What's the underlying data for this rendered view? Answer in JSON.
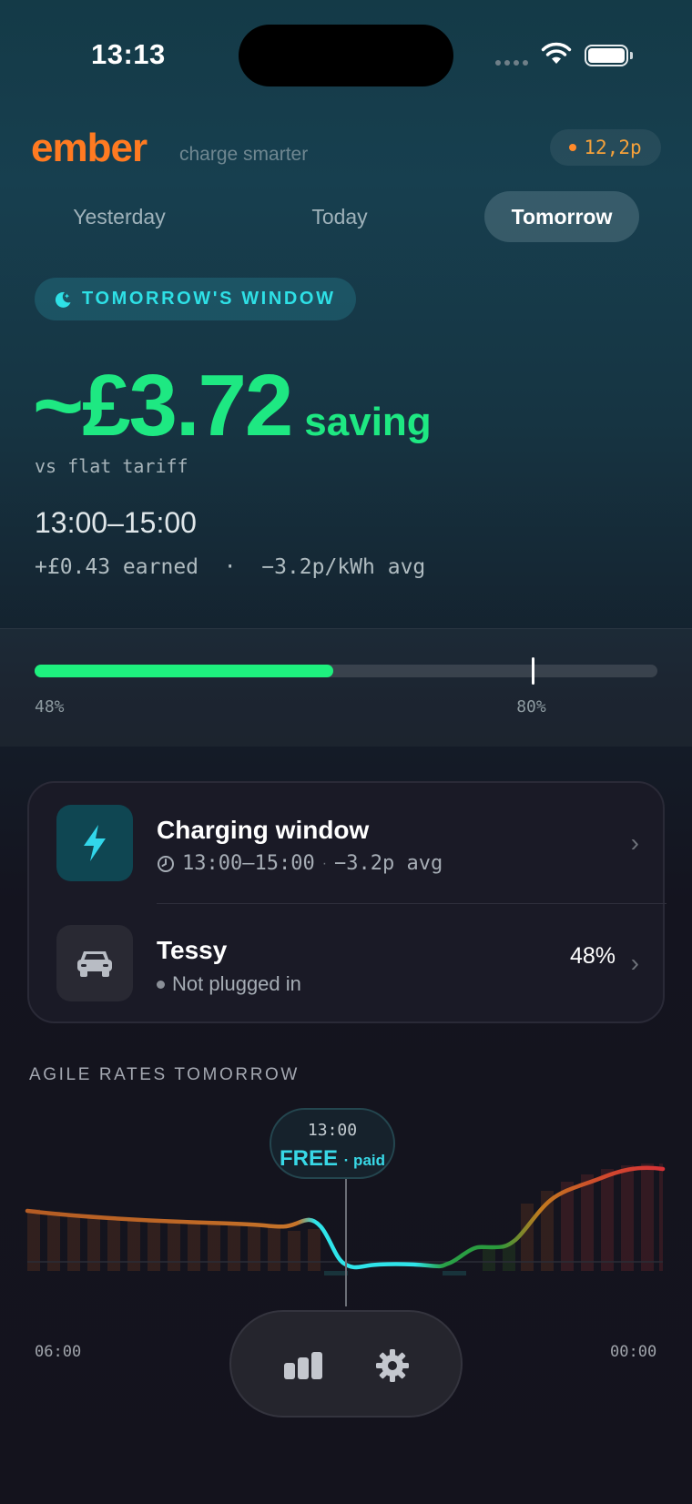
{
  "status_bar": {
    "time": "13:13"
  },
  "header": {
    "brand": "ember",
    "tagline": "charge smarter",
    "current_price": "12,2p",
    "colors": {
      "brand": "#ff7a21",
      "price": "#f5a13a"
    }
  },
  "day_tabs": [
    {
      "label": "Yesterday",
      "active": false
    },
    {
      "label": "Today",
      "active": false
    },
    {
      "label": "Tomorrow",
      "active": true
    }
  ],
  "window": {
    "badge_icon": "moon-icon",
    "badge": "TOMORROW'S WINDOW",
    "saving_amount": "~£3.72",
    "saving_word": "saving",
    "comparison": "vs flat tariff",
    "time_range": "13:00–15:00",
    "meta": "+£0.43 earned  ·  −3.2p/kWh avg",
    "accent": "#1ee882"
  },
  "battery": {
    "current_pct": 48,
    "target_pct": 80,
    "current_label": "48%",
    "target_label": "80%"
  },
  "card": {
    "charging": {
      "icon": "lightning-bolt-icon",
      "title": "Charging window",
      "clock_icon": "clock-icon",
      "subtitle": "13:00–15:00",
      "subtitle_sep": "·",
      "subtitle_tail": "−3.2p avg"
    },
    "vehicle": {
      "icon": "car-icon",
      "name": "Tessy",
      "status": "Not plugged in",
      "battery": "48%"
    }
  },
  "rates": {
    "title": "AGILE RATES TOMORROW",
    "tooltip_time": "13:00",
    "tooltip_price": "FREE",
    "tooltip_suffix": "· paid",
    "x_start_label": "06:00",
    "x_end_label": "00:00"
  },
  "tabbar": {
    "items": [
      "bar-chart-icon",
      "gear-icon"
    ]
  }
}
